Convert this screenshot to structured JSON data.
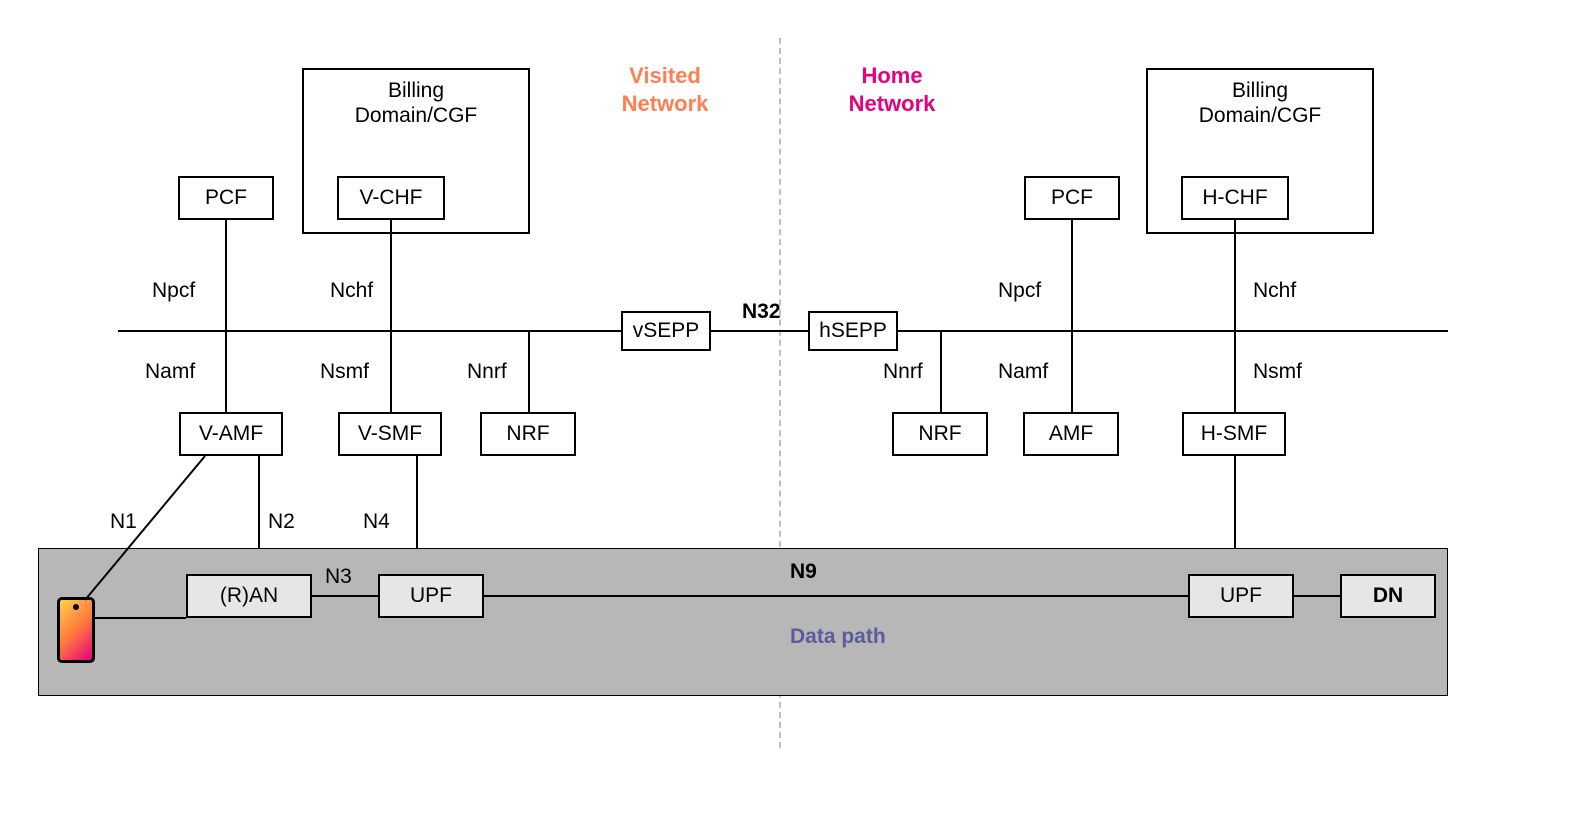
{
  "headers": {
    "visited": "Visited\nNetwork",
    "home": "Home\nNetwork"
  },
  "nodes": {
    "pcf_v": "PCF",
    "billing_v": "Billing\nDomain/CGF",
    "vchf": "V-CHF",
    "vsepp": "vSEPP",
    "hsepp": "hSEPP",
    "pcf_h": "PCF",
    "billing_h": "Billing\nDomain/CGF",
    "hchf": "H-CHF",
    "vamf": "V-AMF",
    "vsmf": "V-SMF",
    "nrf_v": "NRF",
    "nrf_h": "NRF",
    "amf_h": "AMF",
    "hsmf": "H-SMF",
    "ran": "(R)AN",
    "upf_v": "UPF",
    "upf_h": "UPF",
    "dn": "DN"
  },
  "labels": {
    "npcf_v": "Npcf",
    "nchf_v": "Nchf",
    "namf_v": "Namf",
    "nsmf_v": "Nsmf",
    "nnrf_v": "Nnrf",
    "n32": "N32",
    "nnrf_h": "Nnrf",
    "namf_h": "Namf",
    "npcf_h": "Npcf",
    "nchf_h": "Nchf",
    "nsmf_h": "Nsmf",
    "n1": "N1",
    "n2": "N2",
    "n4": "N4",
    "n3": "N3",
    "n9": "N9",
    "datapath": "Data path"
  },
  "colors": {
    "visited": "#ff7f50",
    "home": "#e6007e",
    "datapath_text": "#5b5b9e"
  }
}
